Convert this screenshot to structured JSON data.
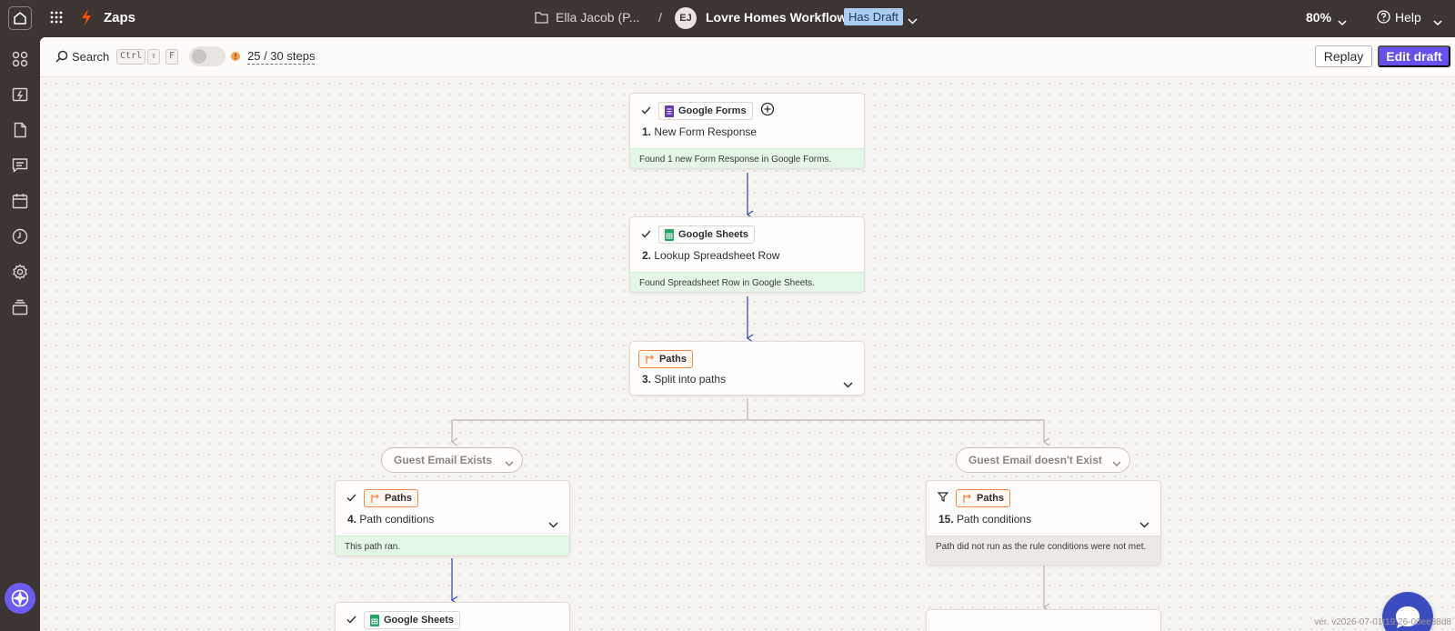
{
  "topbar": {
    "app_name": "Zaps",
    "folder": "Ella Jacob (P...",
    "separator": "/",
    "avatar_initials": "EJ",
    "zap_name": "Lovre Homes Workflow",
    "draft_badge": "Has Draft",
    "zoom": "80%",
    "help": "Help"
  },
  "sidebar": {
    "items": [
      "apps-icon",
      "zap-history-icon",
      "document-icon",
      "chat-icon",
      "calendar-icon",
      "clock-icon",
      "settings-icon",
      "archive-icon",
      "assistant-icon"
    ]
  },
  "toolbar": {
    "search_label": "Search",
    "shortcut_keys": [
      "Ctrl",
      "⇧",
      "F"
    ],
    "warning_glyph": "!",
    "steps_count": "25 / 30 steps",
    "replay_label": "Replay",
    "edit_label": "Edit draft"
  },
  "steps": [
    {
      "app": "Google Forms",
      "number": "1.",
      "name": "New Form Response",
      "status": "Found 1 new Form Response in Google Forms."
    },
    {
      "app": "Google Sheets",
      "number": "2.",
      "name": "Lookup Spreadsheet Row",
      "status": "Found Spreadsheet Row in Google Sheets."
    },
    {
      "app": "Paths",
      "number": "3.",
      "name": "Split into paths"
    },
    {
      "app": "Paths",
      "number": "4.",
      "name": "Path conditions",
      "status": "This path ran."
    },
    {
      "app": "Paths",
      "number": "15.",
      "name": "Path conditions",
      "status": "Path did not run as the rule conditions were not met."
    },
    {
      "app": "Google Sheets"
    }
  ],
  "paths": {
    "left": "Guest Email Exists",
    "right": "Guest Email doesn't Exist"
  },
  "version": "ver. v2026-07-01t19:26-00ee38d8",
  "colors": {
    "topbar": "#3d3533",
    "accent": "#6750f0",
    "connector": "#3b4cc0",
    "success_bg": "#e4f7e6",
    "paths_orange": "#f08a4b"
  }
}
